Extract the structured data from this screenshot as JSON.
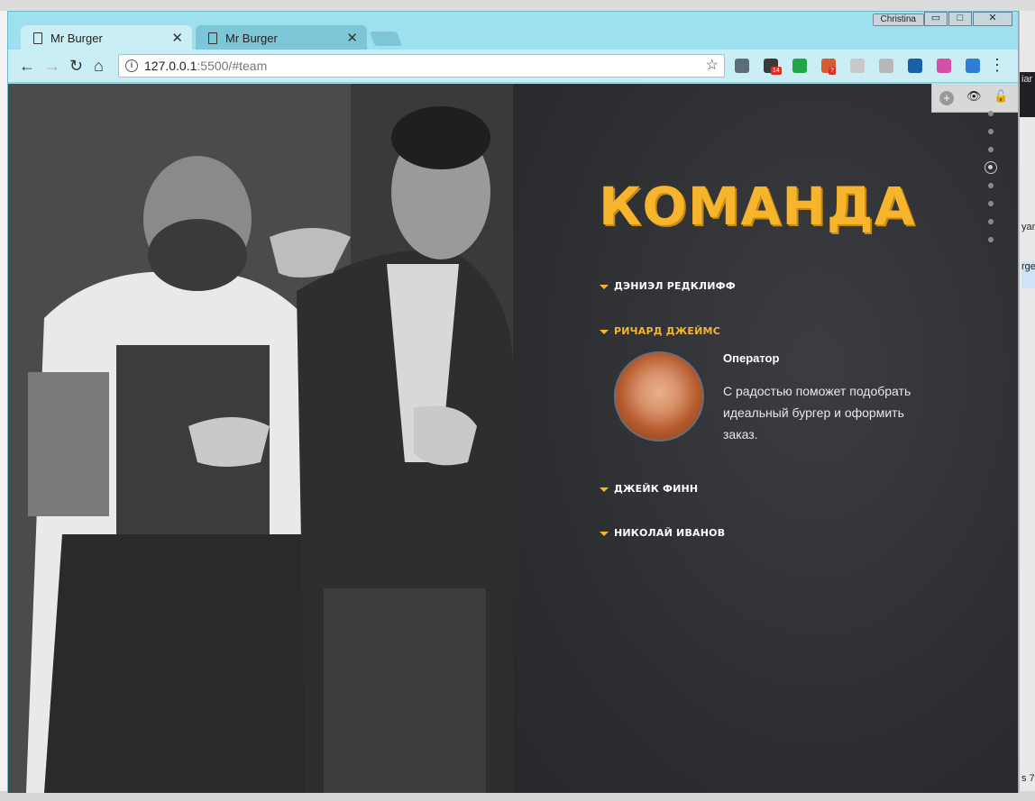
{
  "window": {
    "user": "Christina",
    "controls": {
      "minimize": "▭",
      "maximize": "□",
      "close": "✕"
    }
  },
  "tabs": [
    {
      "title": "Mr Burger",
      "active": true,
      "close": "✕"
    },
    {
      "title": "Mr Burger",
      "active": false,
      "close": "✕"
    }
  ],
  "toolbar": {
    "url_host": "127.0.0.1",
    "url_rest": ":5500/#team",
    "info_icon": "i",
    "star": "☆",
    "back": "←",
    "forward": "→",
    "reload": "↻",
    "home": "⌂",
    "menu": "⋮",
    "extensions": [
      {
        "name": "screenshot-icon",
        "color": "#5b6d7a"
      },
      {
        "name": "accessibility-icon",
        "color": "#3a3a3a",
        "badge": "14"
      },
      {
        "name": "green-circle-icon",
        "color": "#1fa845"
      },
      {
        "name": "colorful-grid-icon",
        "color": "#d85a2f",
        "badge": "?"
      },
      {
        "name": "shield-icon",
        "color": "#c8c8c8"
      },
      {
        "name": "dim-square-icon",
        "color": "#b7b7b7"
      },
      {
        "name": "blue-n-icon",
        "color": "#1b5fa7"
      },
      {
        "name": "gradient-square-icon",
        "color": "#d64ea5"
      },
      {
        "name": "fi-icon",
        "color": "#2d7ed4"
      }
    ]
  },
  "ext_popup": {
    "plus": "+",
    "eye": "👁",
    "lock": "🔓"
  },
  "page": {
    "title": "КОМАНДА",
    "members": [
      {
        "name": "ДЭНИЭЛ РЕДКЛИФФ",
        "active": false
      },
      {
        "name": "РИЧАРД ДЖЕЙМС",
        "active": true
      },
      {
        "name": "ДЖЕЙК ФИНН",
        "active": false
      },
      {
        "name": "НИКОЛАЙ ИВАНОВ",
        "active": false
      }
    ],
    "active_member": {
      "role": "Оператор",
      "description": "С радостью поможет подобрать идеальный бургер и оформить заказ."
    },
    "pagination_dots": 8,
    "active_dot": 3
  },
  "desktop": {
    "right_text_1": "iar",
    "right_text_2": "yan",
    "right_text_3": "rge",
    "right_text_4": "s 7,"
  }
}
